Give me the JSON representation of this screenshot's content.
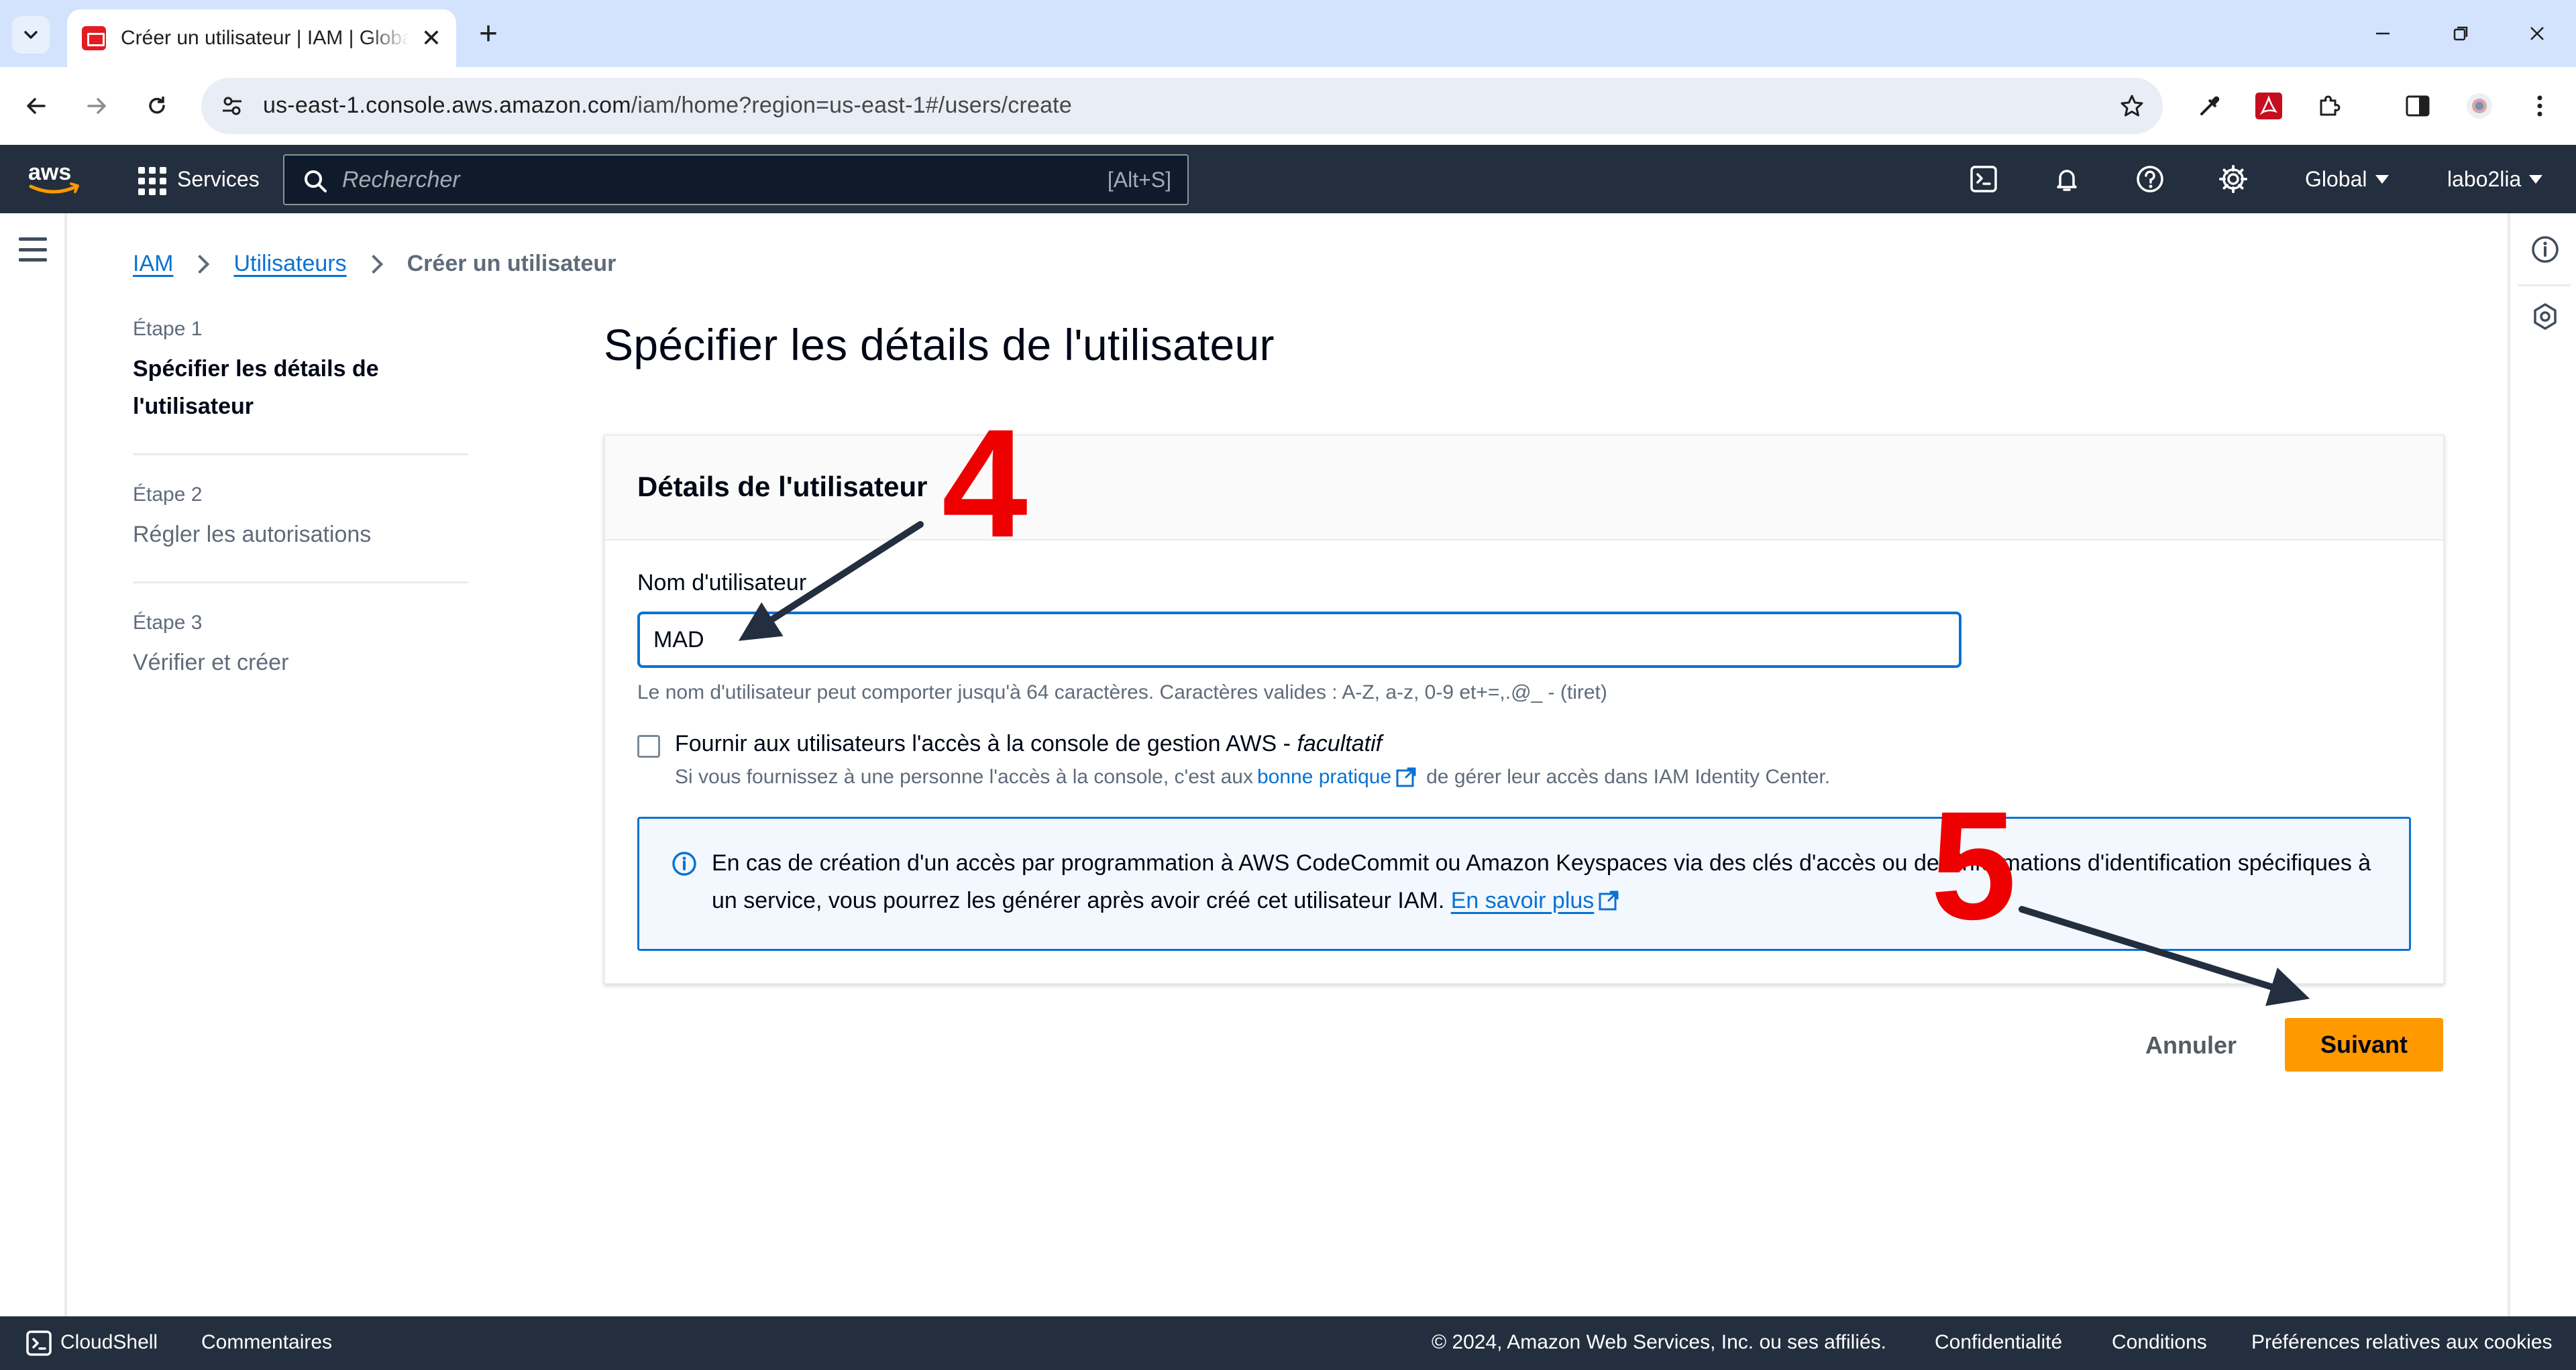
{
  "browser": {
    "tab_title": "Créer un utilisateur | IAM | Global",
    "url_host": "us-east-1.console.aws.amazon.com",
    "url_path": "/iam/home?region=us-east-1#/users/create"
  },
  "topnav": {
    "logo_text": "aws",
    "services_label": "Services",
    "search_placeholder": "Rechercher",
    "search_shortcut": "[Alt+S]",
    "region_label": "Global",
    "account_label": "labo2lia"
  },
  "breadcrumb": {
    "items": [
      "IAM",
      "Utilisateurs"
    ],
    "current": "Créer un utilisateur"
  },
  "steps": [
    {
      "label": "Étape 1",
      "title": "Spécifier les détails de l'utilisateur",
      "active": true
    },
    {
      "label": "Étape 2",
      "title": "Régler les autorisations",
      "active": false
    },
    {
      "label": "Étape 3",
      "title": "Vérifier et créer",
      "active": false
    }
  ],
  "page_title": "Spécifier les détails de l'utilisateur",
  "card": {
    "title": "Détails de l'utilisateur",
    "username_label": "Nom d'utilisateur",
    "username_value": "MAD",
    "username_help": "Le nom d'utilisateur peut comporter jusqu'à 64 caractères. Caractères valides : A-Z, a-z, 0-9 et+=,.@_ - (tiret)",
    "console_access": {
      "label": "Fournir aux utilisateurs l'accès à la console de gestion AWS - ",
      "label_optional": "facultatif",
      "checked": false,
      "desc_before": "Si vous fournissez à une personne l'accès à la console, c'est aux",
      "desc_link": "bonne pratique",
      "desc_after": "de gérer leur accès dans IAM Identity Center."
    },
    "info_alert": {
      "text": "En cas de création d'un accès par programmation à AWS CodeCommit ou Amazon Keyspaces via des clés d'accès ou des informations d'identification spécifiques à un service, vous pourrez les générer après avoir créé cet utilisateur IAM.",
      "link": "En savoir plus"
    }
  },
  "actions": {
    "cancel": "Annuler",
    "next": "Suivant"
  },
  "annotations": {
    "step4": "4",
    "step5": "5",
    "color": "#ee0000"
  },
  "footer": {
    "cloudshell": "CloudShell",
    "feedback": "Commentaires",
    "copyright": "© 2024, Amazon Web Services, Inc. ou ses affiliés.",
    "privacy": "Confidentialité",
    "terms": "Conditions",
    "cookies": "Préférences relatives aux cookies"
  },
  "colors": {
    "aws_nav": "#232f3e",
    "accent_blue": "#0972d3",
    "primary_button": "#ff9900"
  }
}
